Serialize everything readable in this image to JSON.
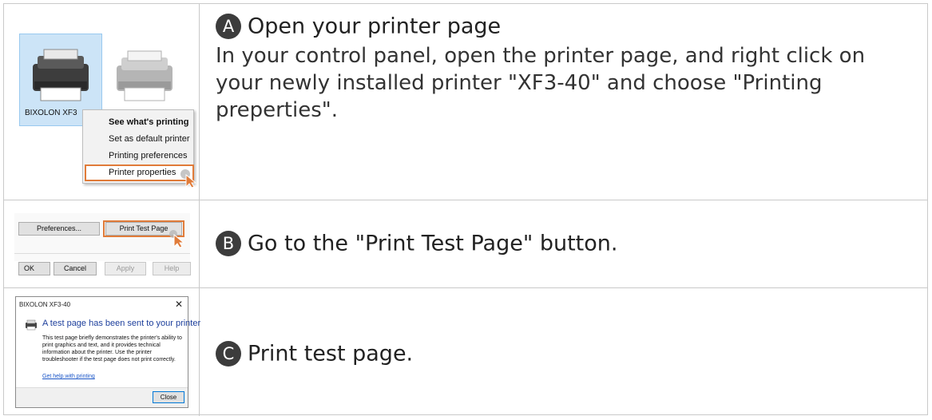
{
  "steps": [
    {
      "letter": "A",
      "title": "Open your printer page",
      "description": "In your control panel, open the printer page, and right click on your newly installed printer \"XF3-40\" and choose \"Printing preperties\"."
    },
    {
      "letter": "B",
      "title": "Go to the \"Print Test Page\" button.",
      "description": ""
    },
    {
      "letter": "C",
      "title": "Print test page.",
      "description": ""
    }
  ],
  "screenshot_a": {
    "printer_name": "BIXOLON XF3",
    "menu_items": [
      "See what's printing",
      "Set as default printer",
      "Printing preferences",
      "Printer properties"
    ]
  },
  "screenshot_b": {
    "preferences_label": "Preferences...",
    "print_test_label": "Print Test Page",
    "ok_label": "OK",
    "cancel_label": "Cancel",
    "apply_label": "Apply",
    "help_label": "Help"
  },
  "screenshot_c": {
    "window_title": "BIXOLON XF3-40",
    "close_glyph": "✕",
    "heading": "A test page has been sent to your printer",
    "body": "This test page briefly demonstrates the printer's ability to print graphics and text, and it provides technical information about the printer. Use the printer troubleshooter if the test page does not print correctly.",
    "link": "Get help with printing",
    "close_label": "Close"
  },
  "colors": {
    "highlight_orange": "#e07b39",
    "selection_blue": "#cce4f7",
    "badge_dark": "#3c3c3c",
    "link_blue": "#1a55c7"
  }
}
